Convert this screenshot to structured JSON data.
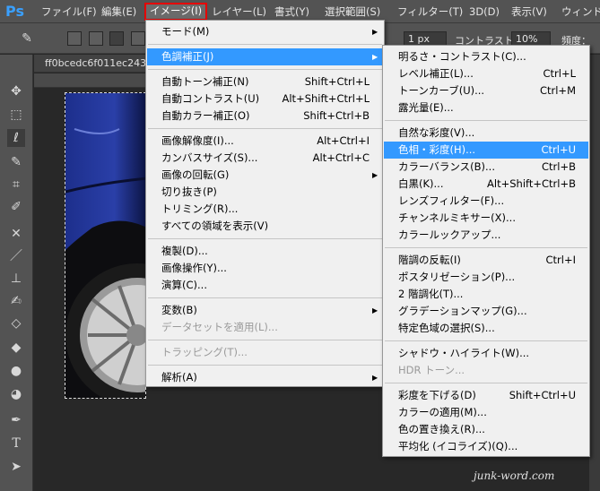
{
  "app": {
    "logo": "Ps"
  },
  "menubar": {
    "items": [
      "ファイル(F)",
      "編集(E)",
      "イメージ(I)",
      "レイヤー(L)",
      "書式(Y)",
      "選択範囲(S)",
      "フィルター(T)",
      "3D(D)",
      "表示(V)",
      "ウィンドウ"
    ]
  },
  "options": {
    "size_label": "1 px",
    "contrast_label": "コントラスト：",
    "contrast_value": "10%",
    "frequency_label": "頻度："
  },
  "document": {
    "tab_title": "ff0bcedc6f011ec243"
  },
  "image_menu": {
    "items": [
      {
        "label": "モード(M)",
        "shortcut": ""
      },
      {
        "label": "色調補正(J)",
        "shortcut": ""
      },
      {
        "label": "自動トーン補正(N)",
        "shortcut": "Shift+Ctrl+L"
      },
      {
        "label": "自動コントラスト(U)",
        "shortcut": "Alt+Shift+Ctrl+L"
      },
      {
        "label": "自動カラー補正(O)",
        "shortcut": "Shift+Ctrl+B"
      },
      {
        "label": "画像解像度(I)...",
        "shortcut": "Alt+Ctrl+I"
      },
      {
        "label": "カンバスサイズ(S)...",
        "shortcut": "Alt+Ctrl+C"
      },
      {
        "label": "画像の回転(G)",
        "shortcut": ""
      },
      {
        "label": "切り抜き(P)",
        "shortcut": ""
      },
      {
        "label": "トリミング(R)...",
        "shortcut": ""
      },
      {
        "label": "すべての領域を表示(V)",
        "shortcut": ""
      },
      {
        "label": "複製(D)...",
        "shortcut": ""
      },
      {
        "label": "画像操作(Y)...",
        "shortcut": ""
      },
      {
        "label": "演算(C)...",
        "shortcut": ""
      },
      {
        "label": "変数(B)",
        "shortcut": ""
      },
      {
        "label": "データセットを適用(L)...",
        "shortcut": ""
      },
      {
        "label": "トラッピング(T)...",
        "shortcut": ""
      },
      {
        "label": "解析(A)",
        "shortcut": ""
      }
    ]
  },
  "adjust_menu": {
    "items": [
      {
        "label": "明るさ・コントラスト(C)...",
        "shortcut": ""
      },
      {
        "label": "レベル補正(L)...",
        "shortcut": "Ctrl+L"
      },
      {
        "label": "トーンカーブ(U)...",
        "shortcut": "Ctrl+M"
      },
      {
        "label": "露光量(E)...",
        "shortcut": ""
      },
      {
        "label": "自然な彩度(V)...",
        "shortcut": ""
      },
      {
        "label": "色相・彩度(H)...",
        "shortcut": "Ctrl+U"
      },
      {
        "label": "カラーバランス(B)...",
        "shortcut": "Ctrl+B"
      },
      {
        "label": "白黒(K)...",
        "shortcut": "Alt+Shift+Ctrl+B"
      },
      {
        "label": "レンズフィルター(F)...",
        "shortcut": ""
      },
      {
        "label": "チャンネルミキサー(X)...",
        "shortcut": ""
      },
      {
        "label": "カラールックアップ...",
        "shortcut": ""
      },
      {
        "label": "階調の反転(I)",
        "shortcut": "Ctrl+I"
      },
      {
        "label": "ポスタリゼーション(P)...",
        "shortcut": ""
      },
      {
        "label": "2 階調化(T)...",
        "shortcut": ""
      },
      {
        "label": "グラデーションマップ(G)...",
        "shortcut": ""
      },
      {
        "label": "特定色域の選択(S)...",
        "shortcut": ""
      },
      {
        "label": "シャドウ・ハイライト(W)...",
        "shortcut": ""
      },
      {
        "label": "HDR トーン...",
        "shortcut": ""
      },
      {
        "label": "彩度を下げる(D)",
        "shortcut": "Shift+Ctrl+U"
      },
      {
        "label": "カラーの適用(M)...",
        "shortcut": ""
      },
      {
        "label": "色の置き換え(R)...",
        "shortcut": ""
      },
      {
        "label": "平均化 (イコライズ)(Q)...",
        "shortcut": ""
      }
    ]
  },
  "watermark": "junk-word.com",
  "colors": {
    "highlight": "#3399ff",
    "menu_bg": "#f0f0f0",
    "app_bg": "#535353",
    "highlight_frame": "#e60000"
  }
}
